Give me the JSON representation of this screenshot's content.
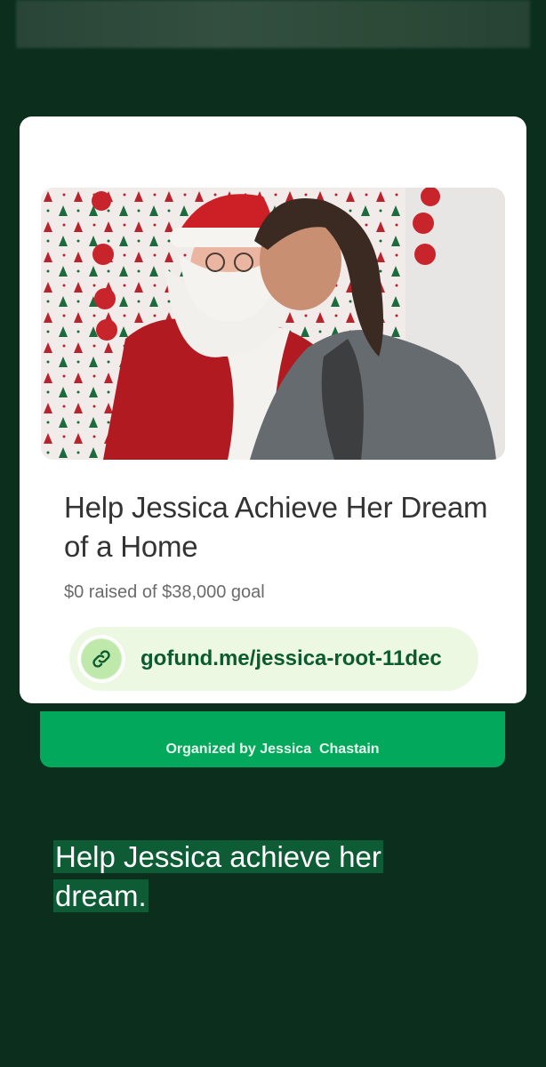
{
  "campaign": {
    "title": "Help Jessica Achieve Her Dream of a Home",
    "raised_text": "$0 raised of $38,000 goal",
    "link": "gofund.me/jessica-root-11dec",
    "organizer_text": "Organized by Jessica  Chastain"
  },
  "caption": {
    "text": "Help Jessica achieve her dream."
  },
  "icons": {
    "link": "link-icon"
  },
  "colors": {
    "background": "#0b2e1d",
    "brand_green": "#02a95c",
    "link_text": "#0c5b2f",
    "pill_bg": "#ecf8e2",
    "caption_highlight": "#0e5c35"
  }
}
